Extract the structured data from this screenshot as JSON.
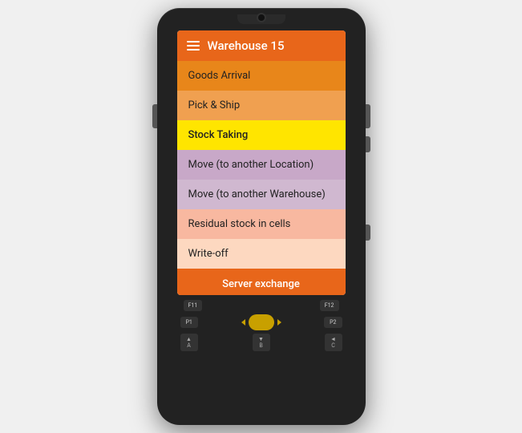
{
  "header": {
    "title": "Warehouse 15",
    "hamburger_label": "menu"
  },
  "menu": {
    "items": [
      {
        "id": "goods-arrival",
        "label": "Goods Arrival",
        "colorClass": "menu-item-goods-arrival"
      },
      {
        "id": "pick-ship",
        "label": "Pick & Ship",
        "colorClass": "menu-item-pick-ship"
      },
      {
        "id": "stock-taking",
        "label": "Stock Taking",
        "colorClass": "menu-item-stock-taking"
      },
      {
        "id": "move-location",
        "label": "Move (to another Location)",
        "colorClass": "menu-item-move-location"
      },
      {
        "id": "move-warehouse",
        "label": "Move (to another Warehouse)",
        "colorClass": "menu-item-move-warehouse"
      },
      {
        "id": "residual-stock",
        "label": "Residual stock in cells",
        "colorClass": "menu-item-residual"
      },
      {
        "id": "write-off",
        "label": "Write-off",
        "colorClass": "menu-item-writeoff"
      }
    ],
    "server_exchange_label": "Server exchange"
  },
  "keypad": {
    "fn_left": "F11",
    "fn_right": "F12",
    "p1": "P1",
    "p2": "P2",
    "buttons": [
      "A",
      "B",
      "C"
    ]
  }
}
